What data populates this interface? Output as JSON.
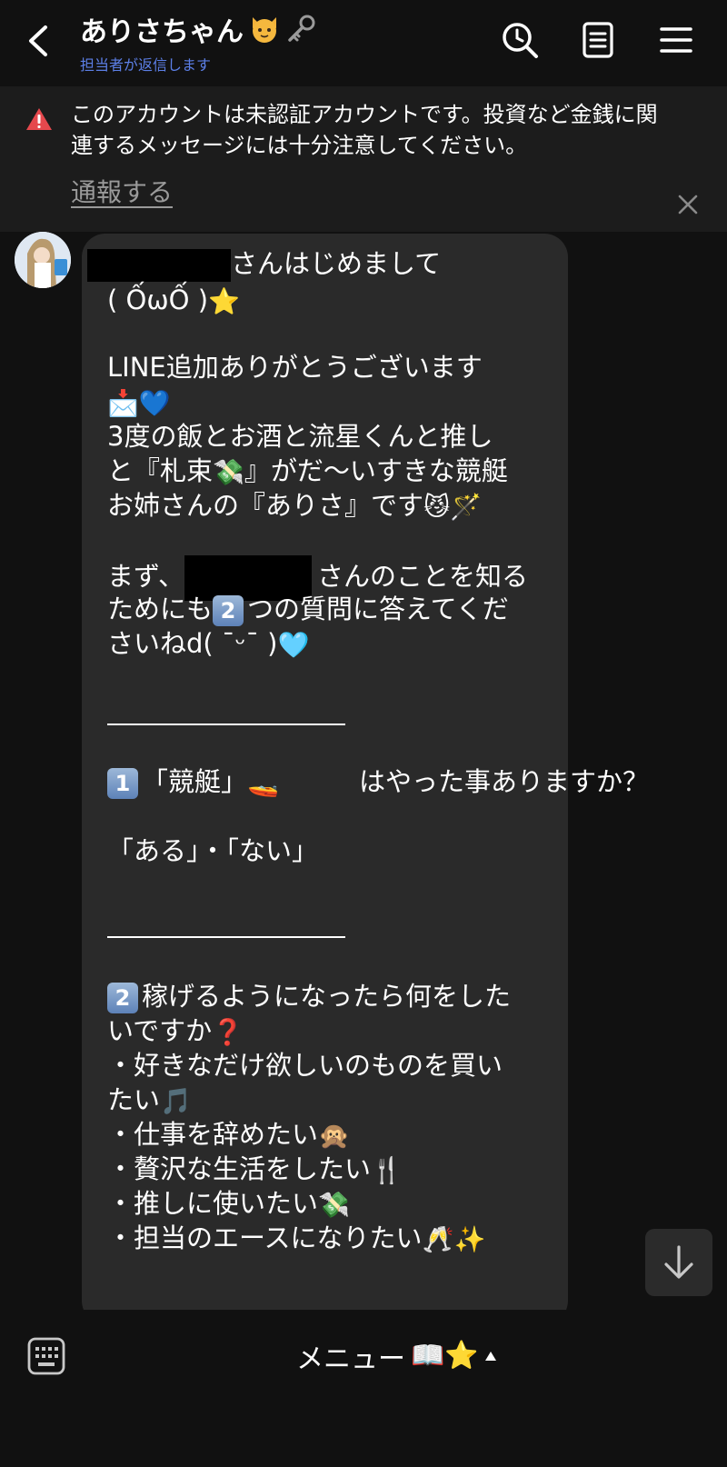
{
  "header": {
    "title": "ありさちゃん",
    "subtitle": "担当者が返信します",
    "title_emoji_icons": [
      "cat-face-icon",
      "key-icon"
    ]
  },
  "banner": {
    "text": "このアカウントは未認証アカウントです。投資など金銭に関連するメッセージには十分注意してください。",
    "link": "通報する"
  },
  "message": {
    "lines": {
      "l1": "さんはじめまして",
      "l2": "( ỐωỐ )",
      "l3": "LINE追加ありがとうございます",
      "l5": "3度の飯とお酒と流星くんと推し",
      "l6a": "と『札束",
      "l6b": "』がだ〜いすきな競艇",
      "l7": "お姉さんの『ありさ』です",
      "l8a": "まず、",
      "l8b": "さんのことを知る",
      "l9a": "ためにも",
      "l9b": "つの質問に答えてくだ",
      "l10": "さいねd( ¯ᵕ¯ )",
      "q1a": "「競艇」",
      "q1b": "はやった事ありますか？",
      "q1_options": "「ある」・「ない」",
      "q2a": "稼げるようになったら何をした",
      "q2b": "いですか",
      "opt1a": "・好きなだけ欲しいのものを買い",
      "opt1b": "たい",
      "opt2": "・仕事を辞めたい",
      "opt3": "・贅沢な生活をしたい",
      "opt4": "・推しに使いたい",
      "opt5": "・担当のエースになりたい"
    },
    "keycaps": {
      "two": "2",
      "one": "1"
    },
    "emojis": {
      "star": "⭐",
      "envelope": "📩",
      "blue_heart": "💙",
      "money_wings": "💸",
      "smirk_cat": "😼",
      "wand": "🪄",
      "light_blue_heart": "🩵",
      "boat": "🚤",
      "question": "❓",
      "music": "🎵",
      "monkey": "🙊",
      "utensils": "🍴",
      "champagne": "🥂",
      "sparkles": "✨"
    }
  },
  "bottom": {
    "menu_label": "メニュー",
    "menu_emojis": "📖⭐"
  }
}
